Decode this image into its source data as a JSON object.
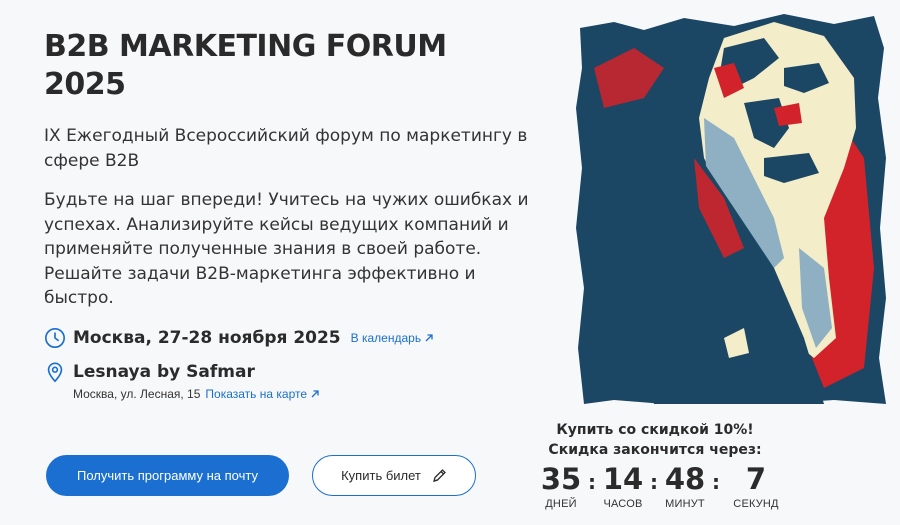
{
  "hero": {
    "title": "B2B MARKETING FORUM 2025",
    "subtitle": "IX Ежегодный Всероссийский форум по маркетингу в сфере B2B",
    "description": "Будьте на шаг впереди! Учитесь на чужих ошибках и успехах. Анализируйте кейсы ведущих компаний и применяйте полученные знания в своей работе. Решайте задачи B2B-маркетинга эффективно и быстро."
  },
  "event": {
    "date": "Москва, 27-28 ноября 2025",
    "calendar_link": "В календарь",
    "venue": "Lesnaya by Safmar",
    "address": "Москва, ул. Лесная, 15",
    "map_link": "Показать на карте",
    "icons": {
      "date": "clock-icon",
      "venue": "location-pin-icon"
    }
  },
  "actions": {
    "primary": "Получить программу на почту",
    "secondary": "Купить билет",
    "secondary_icon": "pencil-icon"
  },
  "promo": {
    "line1": "Купить со скидкой 10%!",
    "line2": "Скидка закончится через:"
  },
  "countdown": {
    "days": "35",
    "days_label": "ДНЕЙ",
    "hours": "14",
    "hours_label": "ЧАСОВ",
    "minutes": "48",
    "minutes_label": "МИНУТ",
    "seconds": "7",
    "seconds_label": "СЕКУНД",
    "separator": ":"
  },
  "colors": {
    "accent": "#1a6fd1",
    "poster_navy": "#1b4664",
    "poster_red": "#d2232a",
    "poster_cream": "#f3edc9",
    "poster_lightblue": "#8fb0c2"
  }
}
